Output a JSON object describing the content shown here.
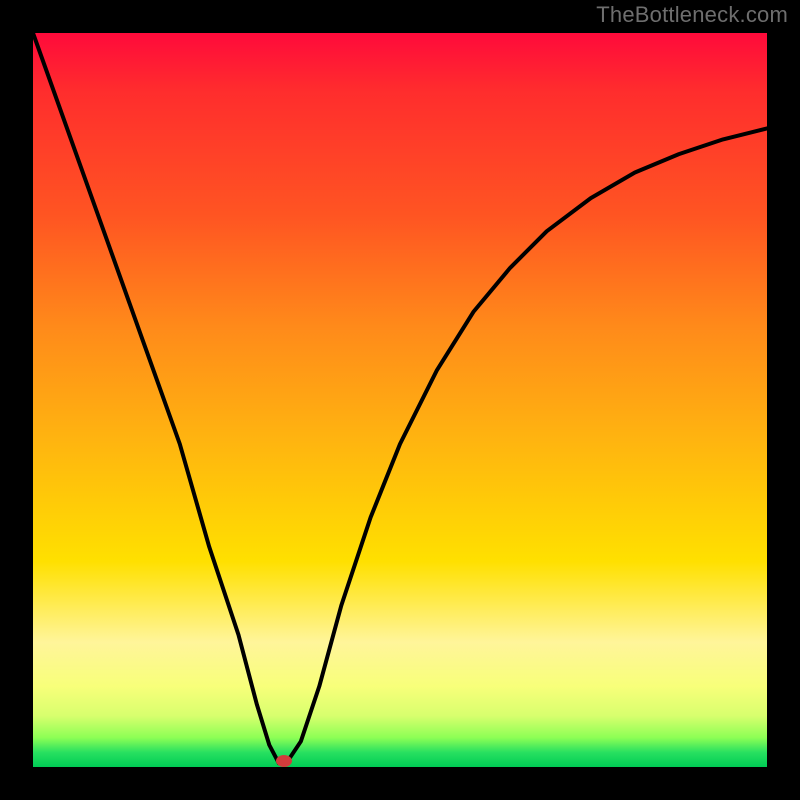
{
  "watermark": "TheBottleneck.com",
  "dot": {
    "x_frac": 0.342,
    "y_frac": 0.992
  },
  "chart_data": {
    "type": "line",
    "title": "",
    "xlabel": "",
    "ylabel": "",
    "xlim": [
      0,
      1
    ],
    "ylim": [
      0,
      1
    ],
    "series": [
      {
        "name": "curve",
        "x": [
          0.0,
          0.05,
          0.1,
          0.15,
          0.2,
          0.24,
          0.28,
          0.305,
          0.322,
          0.335,
          0.345,
          0.365,
          0.39,
          0.42,
          0.46,
          0.5,
          0.55,
          0.6,
          0.65,
          0.7,
          0.76,
          0.82,
          0.88,
          0.94,
          1.0
        ],
        "y": [
          1.0,
          0.86,
          0.72,
          0.58,
          0.44,
          0.3,
          0.18,
          0.085,
          0.03,
          0.005,
          0.005,
          0.035,
          0.11,
          0.22,
          0.34,
          0.44,
          0.54,
          0.62,
          0.68,
          0.73,
          0.775,
          0.81,
          0.835,
          0.855,
          0.87
        ]
      }
    ],
    "marker": {
      "x": 0.342,
      "y": 0.008,
      "color": "#d23c3c"
    },
    "background_gradient": {
      "direction": "vertical",
      "stops": [
        {
          "pos": 0.0,
          "color": "#ff0a3b"
        },
        {
          "pos": 0.25,
          "color": "#ff5522"
        },
        {
          "pos": 0.55,
          "color": "#ffb310"
        },
        {
          "pos": 0.83,
          "color": "#fff59a"
        },
        {
          "pos": 0.96,
          "color": "#8dff55"
        },
        {
          "pos": 1.0,
          "color": "#00cc55"
        }
      ]
    }
  }
}
